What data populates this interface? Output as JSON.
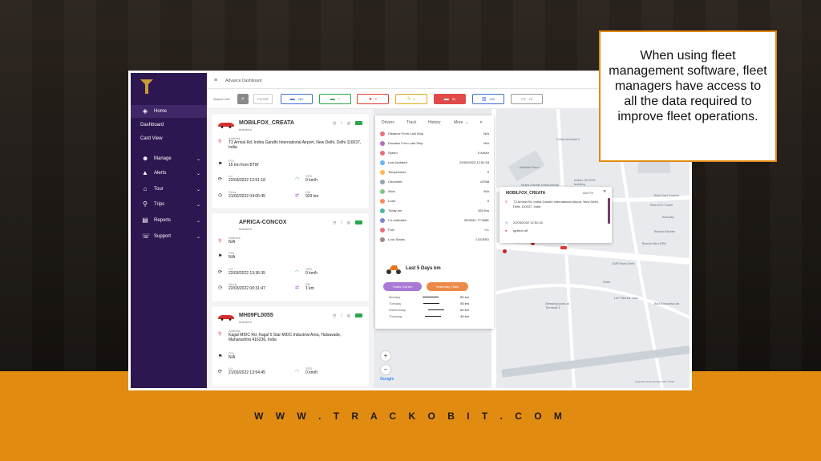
{
  "callout_text": "When using fleet management software, fleet managers have access to all the data required to improve fleet operations.",
  "footer_url": "W W W . T R A C K O B I T . C O M",
  "colors": {
    "sidebar": "#2c1750",
    "accent": "#e18b10",
    "purple_pill": "#a879d6",
    "orange_pill": "#ec8a4a"
  },
  "topbar": {
    "title": "Advance Dashboard",
    "menu_icon": "hamburger-icon"
  },
  "toolbar": {
    "search_label": "Search Veh",
    "filter_label": "FILTER",
    "chips": [
      {
        "count": "282",
        "color": "#3d6fd6",
        "icon": "truck-icon"
      },
      {
        "count": "7",
        "color": "#2fa84f",
        "icon": "truck-icon"
      },
      {
        "count": "0",
        "color": "#e23b2e",
        "icon": "stop-icon"
      },
      {
        "count": "5",
        "color": "#e0a81a",
        "icon": "bolt-icon"
      },
      {
        "count": "90",
        "color": "#e04a4a",
        "icon": "truck-icon"
      },
      {
        "count": "185",
        "color": "#3d6fd6",
        "icon": "chart-icon"
      },
      {
        "count": "74",
        "color": "#777777",
        "icon": "car-icon"
      }
    ]
  },
  "sidebar": {
    "items": [
      {
        "label": "Home",
        "icon": "cube-icon"
      },
      {
        "label": "Dashboard",
        "icon": ""
      },
      {
        "label": "Card View",
        "icon": ""
      },
      {
        "label": "Manage",
        "icon": "users-icon"
      },
      {
        "label": "Alerts",
        "icon": "warning-icon"
      },
      {
        "label": "Tour",
        "icon": "home-icon"
      },
      {
        "label": "Trips",
        "icon": "pin-icon"
      },
      {
        "label": "Reports",
        "icon": "report-icon"
      },
      {
        "label": "Support",
        "icon": "headset-icon"
      }
    ]
  },
  "vehicles": [
    {
      "name": "MOBILFOX_CREATA",
      "client": "testclient",
      "address_label": "Address",
      "address": "T3 Arrival Rd, Indira Gandhi International Airport, New Delhi, Delhi 110037, India",
      "poi_label": "POI",
      "poi": "15 km from BTW",
      "lu_label": "LU",
      "lu": "22/03/2022 12:51:18",
      "spd_label": "SPD",
      "spd": "0 km/h",
      "since_label": "Since",
      "since": "21/02/2022 04:06:45",
      "km_label": "KM",
      "km": "933 km"
    },
    {
      "name": "AFRICA-CONCOX",
      "client": "testclient",
      "address_label": "Address",
      "address": "N/A",
      "poi_label": "POI",
      "poi": "N/A",
      "lu_label": "LU",
      "lu": "22/03/2022 13:36:35",
      "spd_label": "SPD",
      "spd": "0 km/h",
      "since_label": "Since",
      "since": "22/03/2022 00:31:47",
      "km_label": "KM",
      "km": "1 km"
    },
    {
      "name": "MH09FL0055",
      "client": "testclient",
      "address_label": "Address",
      "address": "Kagal MIDC Rd, Kagal 5 Star MIDC Industrial Area, Halsavade, Maharashtra 416236, India",
      "poi_label": "POI",
      "poi": "N/A",
      "lu_label": "LU",
      "lu": "21/03/2022 13:54:45",
      "spd_label": "SPD",
      "spd": "0 km/h"
    }
  ],
  "panel": {
    "tabs": [
      "Drivers",
      "Track",
      "History",
      "More"
    ],
    "rows": [
      {
        "label": "Distance From Last Stop",
        "value": "N/A",
        "color": "#e57373"
      },
      {
        "label": "Duration From Last Stop",
        "value": "N/A",
        "color": "#ba68c8"
      },
      {
        "label": "Speed",
        "value": "0 Km/hr",
        "color": "#e57373"
      },
      {
        "label": "Last Updated",
        "value": "22/03/2022 12:51:18",
        "color": "#64b5f6"
      },
      {
        "label": "Temperature",
        "value": "0",
        "color": "#ffb74d"
      },
      {
        "label": "Odometer",
        "value": "10768",
        "color": "#90a4ae"
      },
      {
        "label": "Altos",
        "value": "N/A",
        "color": "#81c784"
      },
      {
        "label": "Load",
        "value": "0",
        "color": "#ff8a65"
      },
      {
        "label": "Today km",
        "value": "933 Km",
        "color": "#4db6ac"
      },
      {
        "label": "Co-ordinates",
        "value": "28.5542, 77.0881",
        "color": "#7986cb"
      },
      {
        "label": "Fuel",
        "value": "0 L",
        "color": "#e57373"
      },
      {
        "label": "Lock Status",
        "value": "LOCKED",
        "color": "#a1887f"
      }
    ],
    "last5_title": "Last 5 Days km",
    "today_pill": "Today 108 km",
    "yesterday_pill": "Yesterday 79km",
    "days": [
      {
        "day": "Monday",
        "km": "80 km"
      },
      {
        "day": "Tuesday",
        "km": "55 km"
      },
      {
        "day": "Wednesday",
        "km": "80 km"
      },
      {
        "day": "Thursday",
        "km": "49 km"
      }
    ]
  },
  "popup": {
    "title": "MOBILFOX_CREATA",
    "poi": "Add POI",
    "address": "T3 Arrival Rd, Indira Gandhi International Airport, New Delhi, Delhi 110037, India",
    "time": "22/03/2022 12:51:18",
    "ignition": "Ignition off"
  },
  "map": {
    "labels": [
      "Cellar terminal 2",
      "Wilhelm Penn",
      "Indira Gandhi International Airport",
      "Indian Oil GSD building",
      "Blue Dart Courier",
      "New ATC Tower",
      "Aerocity",
      "Airtel Terminal 3",
      "Bharat Kitchen",
      "Sleeping pods at Terminal 3",
      "Brunch Atm ATM",
      "CMR Now Delhi",
      "Subs",
      "L&T Stored, new",
      "Bird Executive Air",
      "Google"
    ],
    "footer": "Keyboard shortcuts   Map data ©2022"
  }
}
